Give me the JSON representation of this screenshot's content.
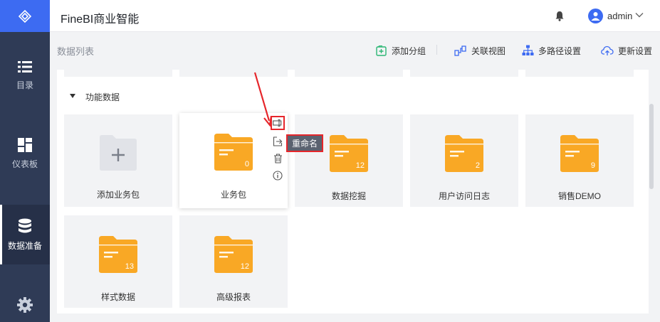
{
  "app": {
    "title": "FineBI商业智能"
  },
  "user": {
    "name": "admin"
  },
  "sidebar": {
    "items": [
      {
        "label": "目录",
        "icon": "list-icon"
      },
      {
        "label": "仪表板",
        "icon": "dashboard-icon"
      },
      {
        "label": "数据准备",
        "icon": "database-icon",
        "active": true
      }
    ],
    "settings_icon": "gear-icon"
  },
  "header": {
    "title": "数据列表",
    "actions": [
      {
        "label": "添加分组",
        "icon": "add-group-icon"
      },
      {
        "label": "关联视图",
        "icon": "relation-view-icon"
      },
      {
        "label": "多路径设置",
        "icon": "multi-path-icon"
      },
      {
        "label": "更新设置",
        "icon": "cloud-update-icon"
      }
    ]
  },
  "group": {
    "name": "功能数据",
    "add_tile_label": "添加业务包",
    "packages": [
      {
        "name": "业务包",
        "count": "0"
      },
      {
        "name": "数据挖掘",
        "count": "12"
      },
      {
        "name": "用户访问日志",
        "count": "2"
      },
      {
        "name": "销售DEMO",
        "count": "9"
      },
      {
        "name": "样式数据",
        "count": "13"
      },
      {
        "name": "高级报表",
        "count": "12"
      }
    ]
  },
  "tile_actions": {
    "tooltip": "重命名",
    "icons": [
      "rename-icon",
      "move-icon",
      "delete-icon",
      "info-icon"
    ]
  },
  "colors": {
    "accent": "#3d6bf2",
    "sidebar": "#2f3b56",
    "folder": "#f9a825",
    "highlight": "#e6262b"
  }
}
